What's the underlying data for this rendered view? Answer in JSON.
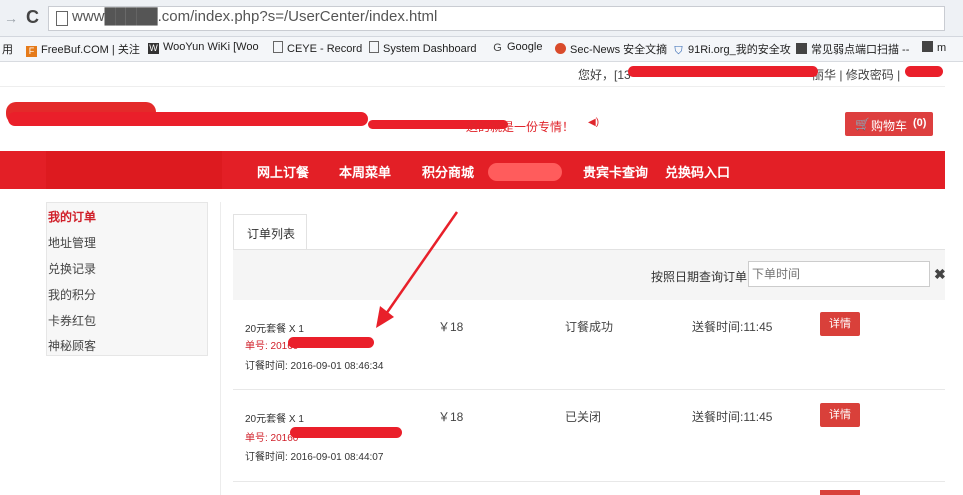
{
  "browser": {
    "nav_forward": "→",
    "reload": "C",
    "url": "www█████.com/index.php?s=/UserCenter/index.html",
    "bookmarks": [
      {
        "label": "用",
        "icon": "apps-icon"
      },
      {
        "label": "FreeBuf.COM | 关注",
        "icon": "freebuf-icon"
      },
      {
        "label": "WooYun WiKi [Woo",
        "icon": "wooyun-icon"
      },
      {
        "label": "CEYE - Record",
        "icon": "page-icon"
      },
      {
        "label": "System Dashboard",
        "icon": "page-icon"
      },
      {
        "label": "Google",
        "icon": "google-icon"
      },
      {
        "label": "Sec-News 安全文摘",
        "icon": "secnews-icon"
      },
      {
        "label": "91Ri.org_我的安全攻",
        "icon": "shield-icon"
      },
      {
        "label": "常见弱点端口扫描 --",
        "icon": "bookmark-icon"
      },
      {
        "label": "m",
        "icon": "bookmark-icon"
      }
    ]
  },
  "header": {
    "greeting": "您好，[13",
    "greeting_tail": "丽华 | 修改密码 |",
    "notice": "送的就是一份专情！",
    "cart_label": "购物车",
    "cart_count": "(0)"
  },
  "mainnav": {
    "items": [
      "网上订餐",
      "本周菜单",
      "积分商城",
      "贵宾卡查询",
      "兑换码入口"
    ]
  },
  "sidebar": {
    "items": [
      "我的订单",
      "地址管理",
      "兑换记录",
      "我的积分",
      "卡券红包",
      "神秘顾客"
    ]
  },
  "orders": {
    "tab_label": "订单列表",
    "filter_label": "按照日期查询订单:",
    "filter_placeholder": "下单时间",
    "clear_icon": "✖",
    "list": [
      {
        "name": "20元套餐 X 1",
        "number": "单号: 20160",
        "time": "订餐时间: 2016-09-01 08:46:34",
        "price": "￥18",
        "status": "订餐成功",
        "delivery": "送餐时间:11:45",
        "detail": "详情"
      },
      {
        "name": "20元套餐 X 1",
        "number": "单号: 20160",
        "time": "订餐时间: 2016-09-01 08:44:07",
        "price": "￥18",
        "status": "已关闭",
        "delivery": "送餐时间:11:45",
        "detail": "详情"
      }
    ]
  },
  "colors": {
    "brand_red": "#e31f26",
    "button_red": "#d9403a",
    "redaction": "#ea1f2a"
  }
}
